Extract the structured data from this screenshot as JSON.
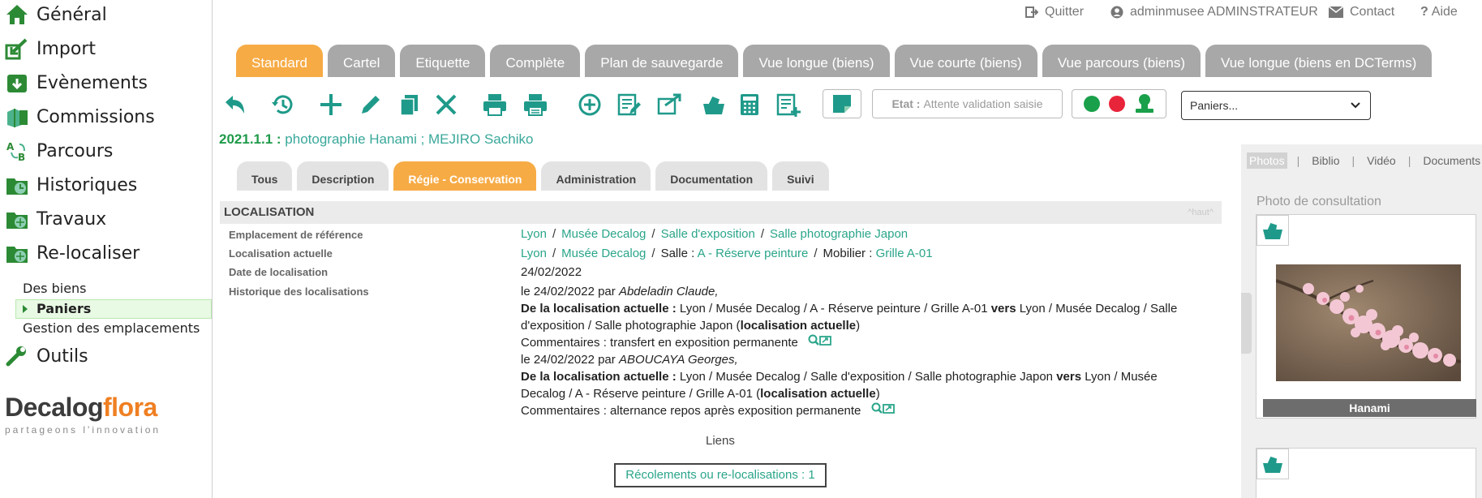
{
  "sidebar": {
    "items": [
      {
        "label": "Général",
        "icon": "home-icon"
      },
      {
        "label": "Import",
        "icon": "import-icon"
      },
      {
        "label": "Evènements",
        "icon": "events-icon"
      },
      {
        "label": "Commissions",
        "icon": "commissions-icon"
      },
      {
        "label": "Parcours",
        "icon": "parcours-icon"
      },
      {
        "label": "Historiques",
        "icon": "historiques-icon"
      },
      {
        "label": "Travaux",
        "icon": "travaux-icon"
      },
      {
        "label": "Re-localiser",
        "icon": "relocaliser-icon"
      }
    ],
    "sub_items": [
      "Des biens",
      "Paniers",
      "Gestion des emplacements"
    ],
    "tools_label": "Outils",
    "logo": {
      "word1": "Decalog",
      "word2": "flora",
      "tagline": "partageons l'innovation"
    }
  },
  "header": {
    "quit": "Quitter",
    "user": "adminmusee ADMINSTRATEUR",
    "contact": "Contact",
    "help": "Aide"
  },
  "main_tabs": [
    "Standard",
    "Cartel",
    "Etiquette",
    "Complète",
    "Plan de sauvegarde",
    "Vue longue (biens)",
    "Vue courte (biens)",
    "Vue parcours (biens)",
    "Vue longue (biens en DCTerms)"
  ],
  "toolbar": {
    "etat_label": "Etat :",
    "etat_value": "Attente validation saisie",
    "paniers_placeholder": "Paniers..."
  },
  "record": {
    "number": "2021.1.1 :",
    "title": "photographie Hanami ; MEJIRO Sachiko"
  },
  "sub_tabs": [
    "Tous",
    "Description",
    "Régie - Conservation",
    "Administration",
    "Documentation",
    "Suivi"
  ],
  "section": {
    "title": "LOCALISATION",
    "top_link": "^haut^",
    "labels": {
      "emplacement": "Emplacement de référence",
      "actuelle": "Localisation actuelle",
      "date": "Date de localisation",
      "historique": "Historique des localisations"
    },
    "emplacement": [
      "Lyon",
      "Musée Decalog",
      "Salle d'exposition",
      "Salle photographie Japon"
    ],
    "actuelle": {
      "lyon": "Lyon",
      "musee": "Musée Decalog",
      "salle_label": "Salle :",
      "salle": "A - Réserve peinture",
      "mobilier_label": "Mobilier :",
      "mobilier": "Grille A-01"
    },
    "date": "24/02/2022",
    "history": [
      {
        "head_prefix": "le 24/02/2022 par ",
        "author": "Abdeladin Claude,",
        "from_label": "De la localisation actuelle :",
        "from_text": " Lyon / Musée Decalog / A - Réserve peinture / Grille A-01  ",
        "vers": "vers",
        "to_text_1": " Lyon / Musée Decalog / Salle",
        "to_text_2": "d'exposition / Salle photographie Japon  (",
        "current_label": "localisation actuelle",
        "close_paren": ")",
        "comment": "Commentaires : transfert en exposition permanente"
      },
      {
        "head_prefix": "le 24/02/2022 par ",
        "author": "ABOUCAYA Georges,",
        "from_label": "De la localisation actuelle :",
        "from_text": " Lyon / Musée Decalog / Salle d'exposition / Salle photographie Japon  ",
        "vers": "vers",
        "to_text_1": " Lyon / Musée",
        "to_text_2": "Decalog / A - Réserve peinture / Grille A-01  (",
        "current_label": "localisation actuelle",
        "close_paren": ")",
        "comment": "Commentaires : alternance repos après exposition permanente"
      }
    ],
    "links_title": "Liens",
    "recolement_button": "Récolements ou re-localisations : 1"
  },
  "right_panel": {
    "tabs": [
      "Photos",
      "Biblio",
      "Vidéo",
      "Documents"
    ],
    "photo_label": "Photo de consultation",
    "photo_caption": "Hanami"
  },
  "colors": {
    "accent_orange": "#f7ab45",
    "tab_grey": "#a8a8a8",
    "icon_teal": "#1f9a8a",
    "link_teal": "#2aa58a",
    "status_green": "#1aa04a",
    "status_red": "#e8243a"
  }
}
